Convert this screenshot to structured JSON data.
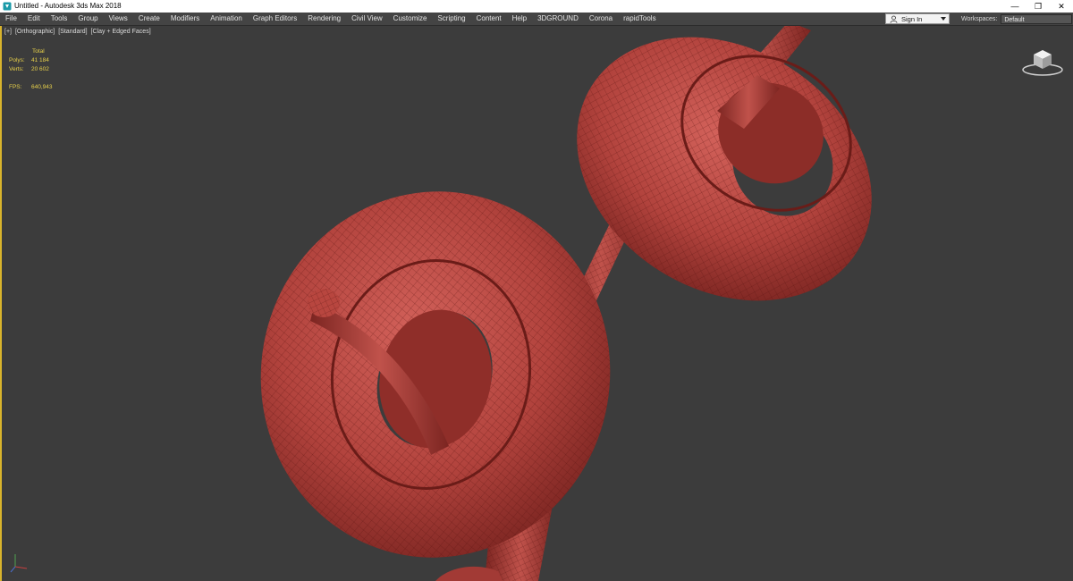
{
  "window": {
    "title": "Untitled - Autodesk 3ds Max 2018",
    "controls": {
      "minimize": "—",
      "restore": "❐",
      "close": "✕"
    }
  },
  "menu": {
    "items": [
      "File",
      "Edit",
      "Tools",
      "Group",
      "Views",
      "Create",
      "Modifiers",
      "Animation",
      "Graph Editors",
      "Rendering",
      "Civil View",
      "Customize",
      "Scripting",
      "Content",
      "Help",
      "3DGROUND",
      "Corona",
      "rapidTools"
    ],
    "sign_in": "Sign In",
    "workspaces_label": "Workspaces:",
    "workspaces_value": "Default"
  },
  "viewport": {
    "label": {
      "plus": "[+]",
      "view": "[Orthographic]",
      "shading": "[Standard]",
      "style": "[Clay + Edged Faces]"
    },
    "stats": {
      "header": "Total",
      "polys_label": "Polys:",
      "polys_value": "41 184",
      "verts_label": "Verts:",
      "verts_value": "20 602",
      "fps_label": "FPS:",
      "fps_value": "640,943"
    }
  },
  "colors": {
    "mesh": "#b2433d",
    "wire": "#5a1512",
    "viewport_bg": "#3c3c3c",
    "active_border": "#d9b42c",
    "stats_text": "#e7d04a"
  },
  "icons": {
    "app": "3dsmax-logo-icon",
    "user": "user-icon",
    "viewcube": "viewcube-icon",
    "axis": "axis-tripod-icon"
  }
}
